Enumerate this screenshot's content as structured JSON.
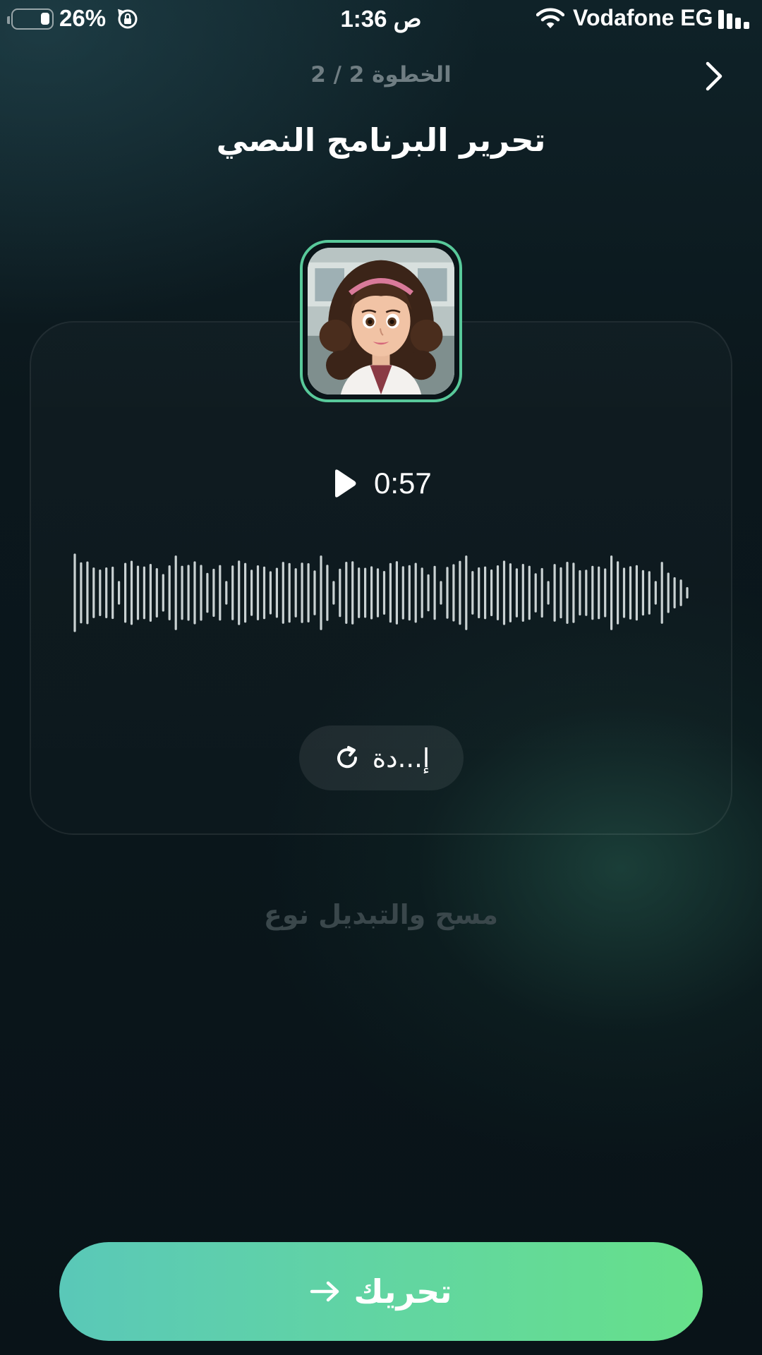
{
  "status_bar": {
    "battery_percent": "26%",
    "battery_level": 0.26,
    "time": "1:36 ص",
    "carrier": "Vodafone EG"
  },
  "header": {
    "step": "الخطوة 2 / 2",
    "back_icon": "chevron-right-icon",
    "title": "تحرير البرنامج النصي"
  },
  "card": {
    "avatar_icon": "character-avatar",
    "avatar_border_color": "#58c99a",
    "duration": "0:57",
    "play_icon": "play-icon",
    "retry_label": "إ...دة",
    "retry_icon": "refresh-icon"
  },
  "switch_link": "مسح والتبديل نوع",
  "cta": {
    "label": "تحريك",
    "icon": "arrow-right-icon",
    "gradient": [
      "#5ac8b8",
      "#66e08a"
    ]
  }
}
